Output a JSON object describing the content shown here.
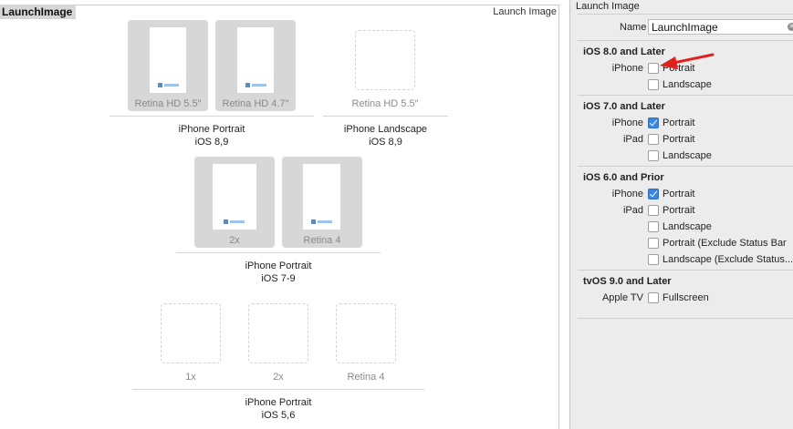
{
  "canvas": {
    "set_name": "LaunchImage",
    "set_type": "Launch Image",
    "groups": [
      {
        "title_line1": "iPhone Portrait",
        "title_line2": "iOS 8,9",
        "slots": [
          "Retina HD 5.5″",
          "Retina HD 4.7″"
        ]
      },
      {
        "title_line1": "iPhone Landscape",
        "title_line2": "iOS 8,9",
        "slots": [
          "Retina HD 5.5″"
        ]
      },
      {
        "title_line1": "iPhone Portrait",
        "title_line2": "iOS 7-9",
        "slots": [
          "2x",
          "Retina 4"
        ]
      },
      {
        "title_line1": "iPhone Portrait",
        "title_line2": "iOS 5,6",
        "slots": [
          "1x",
          "2x",
          "Retina 4"
        ]
      }
    ]
  },
  "inspector": {
    "title": "Launch Image",
    "name_label": "Name",
    "name_value": "LaunchImage",
    "sections": [
      {
        "title": "iOS 8.0 and Later",
        "rows": [
          {
            "device": "iPhone",
            "label": "Portrait",
            "checked": false
          },
          {
            "device": "",
            "label": "Landscape",
            "checked": false
          }
        ]
      },
      {
        "title": "iOS 7.0 and Later",
        "rows": [
          {
            "device": "iPhone",
            "label": "Portrait",
            "checked": true
          },
          {
            "device": "iPad",
            "label": "Portrait",
            "checked": false
          },
          {
            "device": "",
            "label": "Landscape",
            "checked": false
          }
        ]
      },
      {
        "title": "iOS 6.0 and Prior",
        "rows": [
          {
            "device": "iPhone",
            "label": "Portrait",
            "checked": true
          },
          {
            "device": "iPad",
            "label": "Portrait",
            "checked": false
          },
          {
            "device": "",
            "label": "Landscape",
            "checked": false
          },
          {
            "device": "",
            "label": "Portrait (Exclude Status Bar",
            "checked": false
          },
          {
            "device": "",
            "label": "Landscape (Exclude Status...",
            "checked": false
          }
        ]
      },
      {
        "title": "tvOS 9.0 and Later",
        "rows": [
          {
            "device": "Apple TV",
            "label": "Fullscreen",
            "checked": false
          }
        ]
      }
    ]
  },
  "colors": {
    "accent": "#3b87e0",
    "annotation_arrow": "#e0201b",
    "well": "#d7d7d7"
  }
}
